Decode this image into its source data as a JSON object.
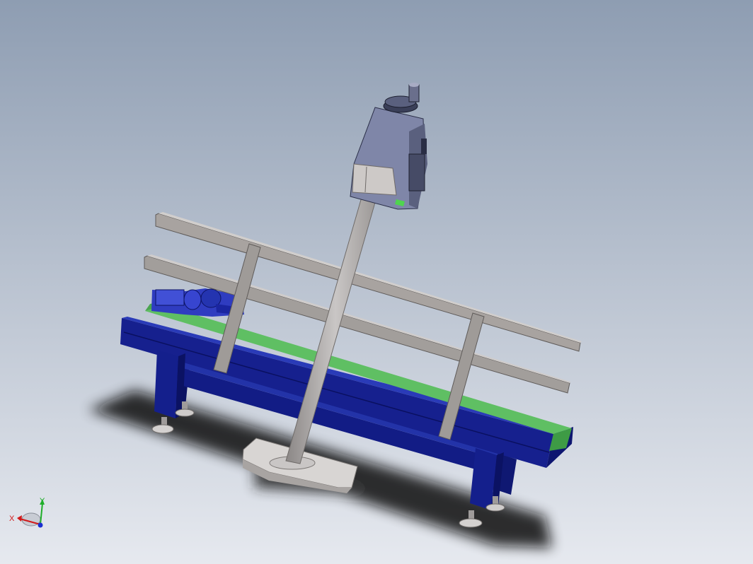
{
  "viewport": {
    "background_top": "#8e9db2",
    "background_bottom": "#e6e9ef"
  },
  "colors": {
    "frame_blue": "#141f8c",
    "frame_blue_dark": "#0b1263",
    "frame_blue_light": "#2434b0",
    "belt_green": "#5fbf63",
    "belt_green_dark": "#3e9b45",
    "rail_gray": "#a8a3a0",
    "rail_gray_dark": "#6f6b69",
    "pole_gray": "#a9a5a4",
    "base_light": "#d8d5d3",
    "motor_blue": "#3844c8",
    "scanner_body": "#7f86a8",
    "axis_x": "#d11a1a",
    "axis_y": "#1fae2a",
    "axis_z": "#1a2fd1"
  },
  "model": {
    "parts": [
      "conveyor-frame",
      "conveyor-belt",
      "side-guard-rails",
      "drive-motor",
      "leveling-feet",
      "vertical-pole",
      "pole-base-plate",
      "scanner-head"
    ]
  },
  "triad": {
    "x_label": "X",
    "y_label": "Y",
    "icon": "coordinate-triad-icon"
  }
}
